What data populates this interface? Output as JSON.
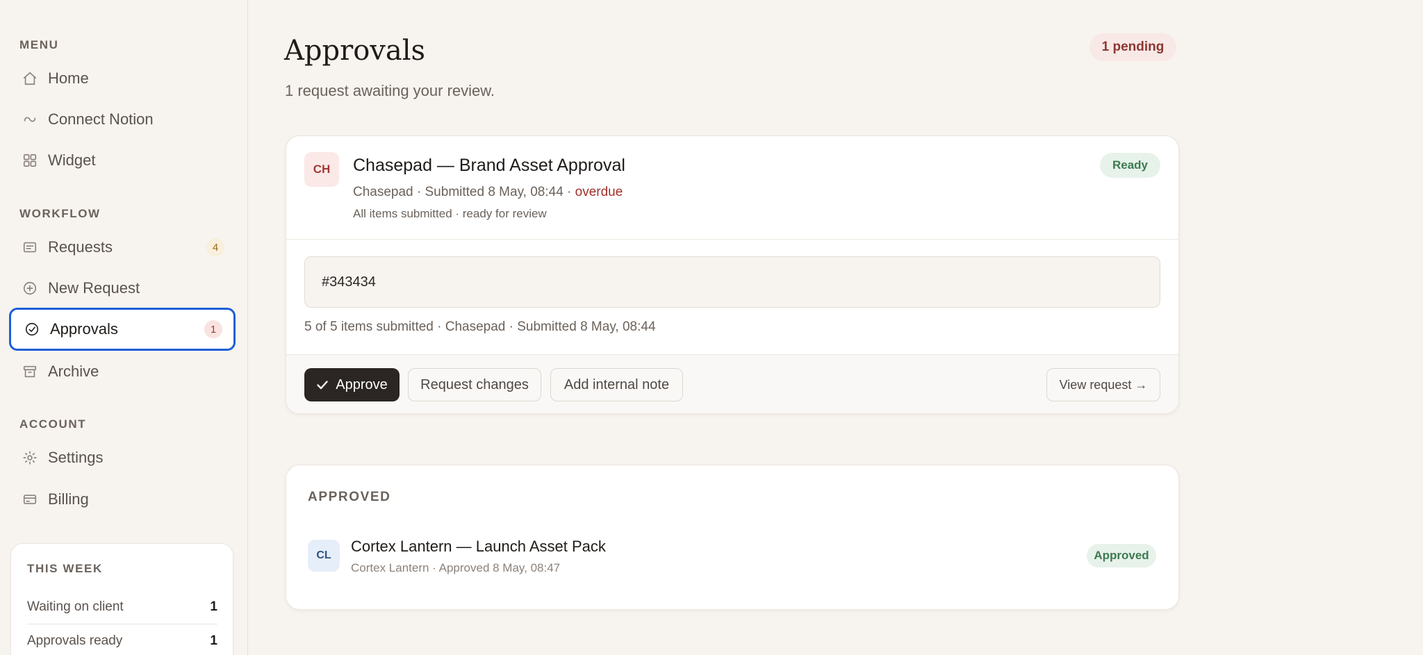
{
  "sidebar": {
    "menu_label": "MENU",
    "workflow_label": "WORKFLOW",
    "account_label": "ACCOUNT",
    "items": [
      {
        "label": "Home",
        "icon": "home-icon"
      },
      {
        "label": "Connect Notion",
        "icon": "link-icon"
      },
      {
        "label": "Widget",
        "icon": "grid-icon"
      },
      {
        "label": "Requests",
        "icon": "inbox-icon",
        "count": "4"
      },
      {
        "label": "New Request",
        "icon": "plus-circle-icon"
      },
      {
        "label": "Approvals",
        "icon": "check-circle-icon",
        "count": "1",
        "active": true
      },
      {
        "label": "Archive",
        "icon": "archive-icon"
      },
      {
        "label": "Settings",
        "icon": "gear-icon"
      },
      {
        "label": "Billing",
        "icon": "credit-card-icon"
      }
    ],
    "this_week": {
      "title": "THIS WEEK",
      "rows": [
        {
          "label": "Waiting on client",
          "value": "1"
        },
        {
          "label": "Approvals ready",
          "value": "1"
        }
      ]
    }
  },
  "main": {
    "title": "Approvals",
    "subtitle": "1 request awaiting your review.",
    "pending_badge": "1 pending",
    "request": {
      "avatar": "CH",
      "title": "Chasepad — Brand Asset Approval",
      "meta": "Chasepad · Submitted 8 May, 08:44 · ",
      "overdue": "overdue",
      "sub": "All items submitted · ready for review",
      "status": "Ready",
      "color_value": "#343434",
      "items_line": "5 of 5 items submitted · Chasepad · Submitted 8 May, 08:44",
      "actions": {
        "approve": "Approve",
        "request_changes": "Request changes",
        "add_note": "Add internal note",
        "view": "View request →"
      }
    },
    "approved": {
      "label": "APPROVED",
      "items": [
        {
          "avatar": "CL",
          "title": "Cortex Lantern — Launch Asset Pack",
          "meta": "Cortex Lantern · Approved 8 May, 08:47",
          "status": "Approved"
        }
      ]
    }
  },
  "colors": {
    "background": "#f7f3ef",
    "active_border": "#1d5fd6",
    "primary_button": "#2b2623",
    "overdue": "#a2302a",
    "success": "#3d7a52"
  }
}
